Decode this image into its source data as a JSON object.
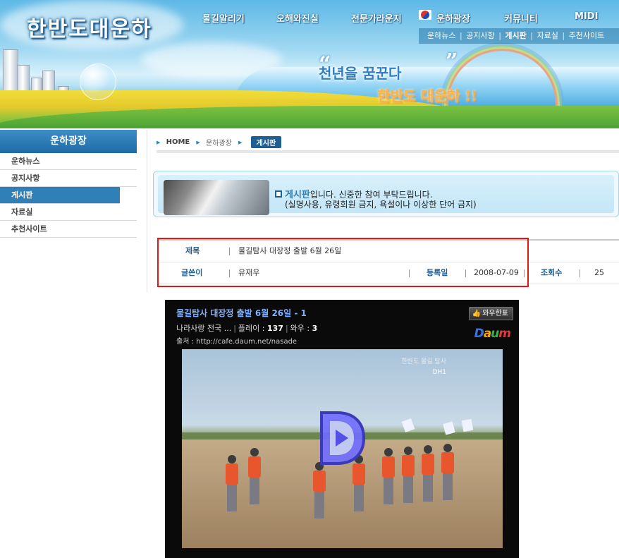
{
  "site": {
    "logo": "한반도대운하",
    "nav": [
      "물길알리기",
      "오해와진실",
      "전문가라운지",
      "운하광장",
      "커뮤니티",
      "MIDI"
    ],
    "subnav": [
      "운하뉴스",
      "공지사항",
      "게시판",
      "자료실",
      "추천사이트"
    ],
    "subnav_active": 2,
    "slogan_line1": "천년을 꿈꾼다",
    "slogan_line2": "한반도 대운하 !!",
    "quote_open": "“",
    "quote_close": "”"
  },
  "sidebar": {
    "title": "운하광장",
    "items": [
      {
        "label": "운하뉴스",
        "active": false
      },
      {
        "label": "공지사항",
        "active": false
      },
      {
        "label": "게시판",
        "active": true
      },
      {
        "label": "자료실",
        "active": false
      },
      {
        "label": "추천사이트",
        "active": false
      }
    ]
  },
  "breadcrumb": {
    "home": "HOME",
    "section": "운하광장",
    "current": "게시판"
  },
  "notice": {
    "keyword": "게시판",
    "line1_rest": "입니다. 신중한 참여 부탁드립니다.",
    "line2": "(실명사용, 유령회원 금지, 욕설이나 이상한 단어 금지)"
  },
  "post": {
    "title_label": "제목",
    "title_value": "물길탐사 대장정 출발 6월 26일",
    "author_label": "글쓴이",
    "author_value": "유재우",
    "date_label": "등록일",
    "date_value": "2008-07-09",
    "views_label": "조회수",
    "views_value": "25"
  },
  "player": {
    "title": "물길탐사 대장정 출발 6월 26일 - 1",
    "vote_label": "와우한표",
    "channel": "나라사랑 전국 ...",
    "plays_label": "플레이 :",
    "plays_value": "137",
    "wow_label": "와우 :",
    "wow_value": "3",
    "source_label": "출처 :",
    "source_url": "http://cafe.daum.net/nasade",
    "logo_parts": [
      "D",
      "a",
      "u",
      "m"
    ],
    "watermark": "한반도 물길 탐사",
    "channel_tag": "DH1"
  },
  "colors": {
    "brand_blue": "#1f5f92",
    "sidebar_active": "#2f7fb8",
    "highlight_red": "#e01818",
    "player_title": "#7fb0ff"
  }
}
